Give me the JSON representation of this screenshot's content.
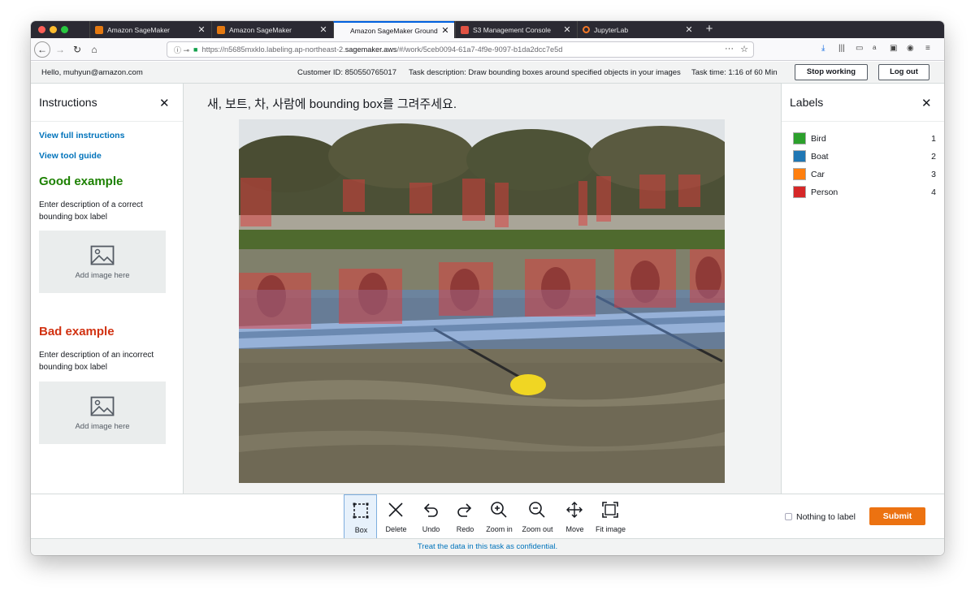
{
  "browser": {
    "tabs": [
      {
        "title": "Amazon SageMaker",
        "favicon": "sagemaker-icon",
        "active": false
      },
      {
        "title": "Amazon SageMaker",
        "favicon": "sagemaker-icon",
        "active": false
      },
      {
        "title": "Amazon SageMaker Ground Tru",
        "favicon": "",
        "active": true
      },
      {
        "title": "S3 Management Console",
        "favicon": "s3-icon",
        "active": false
      },
      {
        "title": "JupyterLab",
        "favicon": "jupyter-icon",
        "active": false
      }
    ],
    "new_tab": "+",
    "url_host": "https://n5685mxklo.labeling.ap-northeast-2.",
    "url_domain": "sagemaker.aws",
    "url_path": "/#/work/5ceb0094-61a7-4f9e-9097-b1da2dcc7e5d",
    "menu_dots": "···",
    "bookmark": "☆"
  },
  "header": {
    "greeting": "Hello, muhyun@amazon.com",
    "customer_id": "Customer ID: 850550765017",
    "task_description": "Task description: Draw bounding boxes around specified objects in your images",
    "task_time": "Task time: 1:16 of 60 Min",
    "stop_label": "Stop working",
    "logout_label": "Log out"
  },
  "instructions": {
    "title": "Instructions",
    "close": "✕",
    "view_full": "View full instructions",
    "view_tool": "View tool guide",
    "good_title": "Good example",
    "good_text": "Enter description of a correct bounding box label",
    "good_image": "Add image here",
    "bad_title": "Bad example",
    "bad_text": "Enter description of an incorrect bounding box label",
    "bad_image": "Add image here"
  },
  "task": {
    "prompt": "새, 보트, 차, 사람에 bounding box를 그려주세요."
  },
  "labels": {
    "title": "Labels",
    "close": "✕",
    "items": [
      {
        "name": "Bird",
        "key": "1",
        "color": "#2ca02c"
      },
      {
        "name": "Boat",
        "key": "2",
        "color": "#1f77b4"
      },
      {
        "name": "Car",
        "key": "3",
        "color": "#ff7f0e"
      },
      {
        "name": "Person",
        "key": "4",
        "color": "#d62728"
      }
    ]
  },
  "toolbar": {
    "tools": [
      {
        "label": "Box",
        "icon": "box-icon",
        "active": true
      },
      {
        "label": "Delete",
        "icon": "delete-icon",
        "active": false
      },
      {
        "label": "Undo",
        "icon": "undo-icon",
        "active": false
      },
      {
        "label": "Redo",
        "icon": "redo-icon",
        "active": false
      },
      {
        "label": "Zoom in",
        "icon": "zoom-in-icon",
        "active": false
      },
      {
        "label": "Zoom out",
        "icon": "zoom-out-icon",
        "active": false
      },
      {
        "label": "Move",
        "icon": "move-icon",
        "active": false
      },
      {
        "label": "Fit image",
        "icon": "fit-image-icon",
        "active": false
      }
    ],
    "nothing_to_label": "Nothing to label",
    "submit": "Submit"
  },
  "footer": {
    "text": "Treat the data in this task as confidential."
  }
}
